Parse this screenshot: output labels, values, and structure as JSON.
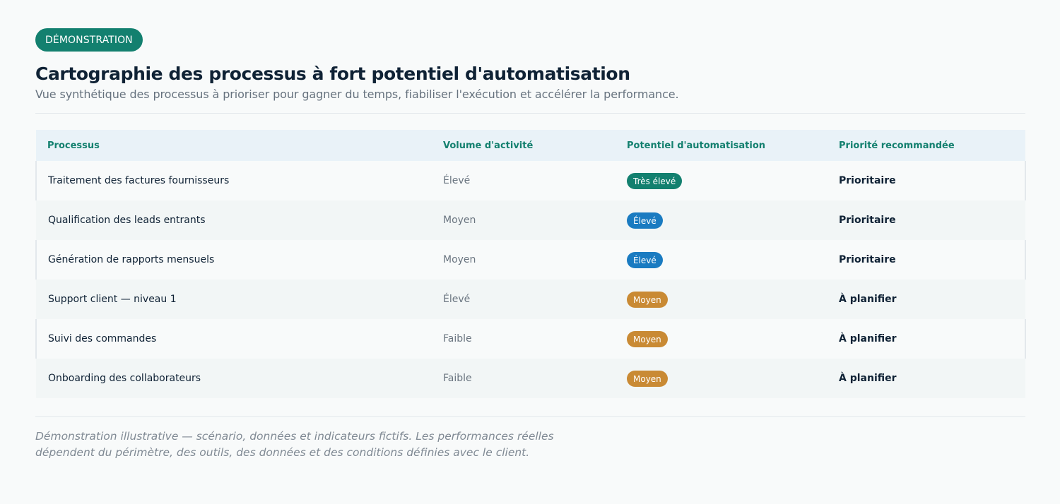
{
  "header": {
    "tag": "DÉMONSTRATION",
    "title": "Cartographie des processus à fort potentiel d'automatisation",
    "subtitle": "Vue synthétique des processus à prioriser pour gagner du temps, fiabiliser l'exécution et accélérer la performance."
  },
  "table": {
    "columns": [
      "Processus",
      "Volume d'activité",
      "Potentiel d'automatisation",
      "Priorité recommandée"
    ],
    "rows": [
      {
        "process": "Traitement des factures fournisseurs",
        "volume": "Élevé",
        "potential": "Très élevé",
        "potential_color": "#13806f",
        "priority": "Prioritaire"
      },
      {
        "process": "Qualification des leads entrants",
        "volume": "Moyen",
        "potential": "Élevé",
        "potential_color": "#1a7bc1",
        "priority": "Prioritaire"
      },
      {
        "process": "Génération de rapports mensuels",
        "volume": "Moyen",
        "potential": "Élevé",
        "potential_color": "#1a7bc1",
        "priority": "Prioritaire"
      },
      {
        "process": "Support client — niveau 1",
        "volume": "Élevé",
        "potential": "Moyen",
        "potential_color": "#c98a34",
        "priority": "À planifier"
      },
      {
        "process": "Suivi des commandes",
        "volume": "Faible",
        "potential": "Moyen",
        "potential_color": "#c98a34",
        "priority": "À planifier"
      },
      {
        "process": "Onboarding des collaborateurs",
        "volume": "Faible",
        "potential": "Moyen",
        "potential_color": "#c98a34",
        "priority": "À planifier"
      }
    ]
  },
  "footer": {
    "note": "Démonstration illustrative — scénario, données et indicateurs fictifs. Les performances réelles dépendent du périmètre, des outils, des données et des conditions définies avec le client."
  },
  "colors": {
    "accent": "#13806f",
    "blue": "#1a7bc1",
    "amber": "#c98a34"
  }
}
